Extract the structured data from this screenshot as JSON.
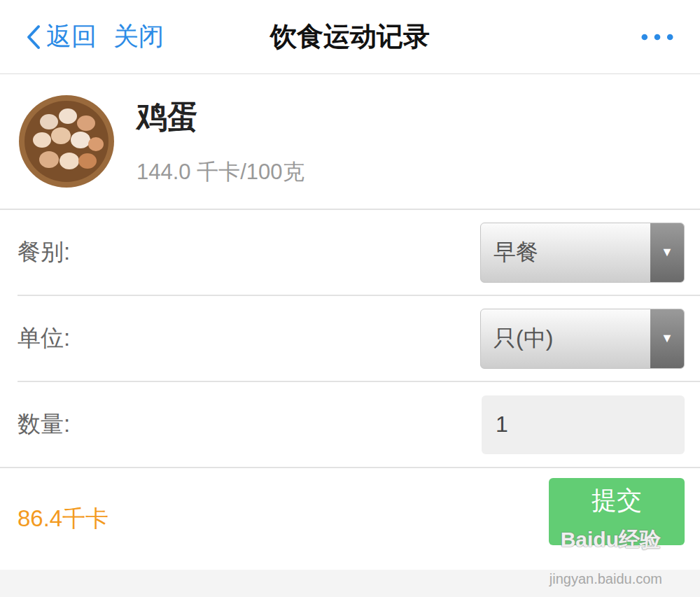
{
  "nav": {
    "back": "返回",
    "close": "关闭",
    "title": "饮食运动记录"
  },
  "food": {
    "name": "鸡蛋",
    "calories": "144.0 千卡/100克"
  },
  "fields": [
    {
      "label": "餐别:",
      "kind": "select",
      "value": "早餐",
      "arrow": "▼"
    },
    {
      "label": "单位:",
      "kind": "select",
      "value": "只(中)",
      "arrow": "▼"
    },
    {
      "label": "数量:",
      "kind": "input",
      "value": "1"
    }
  ],
  "total": "86.4千卡",
  "submit": "提交",
  "watermark": {
    "logo": "Baidu经验",
    "url": "jingyan.baidu.com"
  }
}
